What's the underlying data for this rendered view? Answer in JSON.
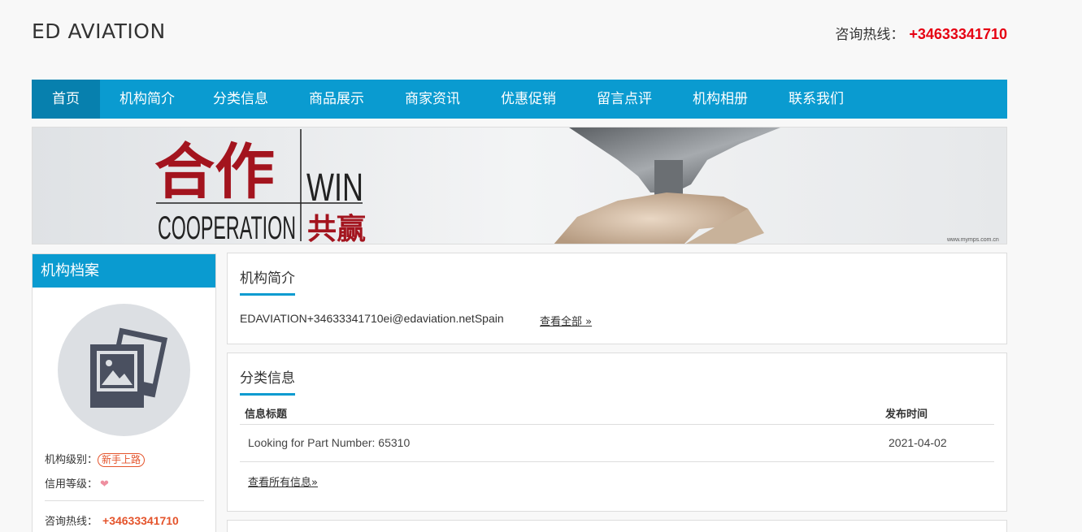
{
  "header": {
    "site_name": "ED AVIATION",
    "hotline_label": "咨询热线：",
    "hotline_number": "+34633341710"
  },
  "nav": {
    "items": [
      {
        "label": "首页",
        "active": true
      },
      {
        "label": "机构简介"
      },
      {
        "label": "分类信息"
      },
      {
        "label": "商品展示"
      },
      {
        "label": "商家资讯"
      },
      {
        "label": "优惠促销"
      },
      {
        "label": "留言点评"
      },
      {
        "label": "机构相册"
      },
      {
        "label": "联系我们"
      }
    ]
  },
  "banner": {
    "chinese_top": "合作",
    "win": "WIN",
    "cooperation": "COOPERATION",
    "chinese_bottom": "共赢",
    "watermark": "www.mymps.com.cn"
  },
  "sidebar": {
    "title": "机构档案",
    "avatar_icon": "photo-placeholder-icon",
    "level_label": "机构级别：",
    "level_badge": "新手上路",
    "credit_label": "信用等级：",
    "credit_icon": "heart-icon",
    "hotline_label": "咨询热线：",
    "hotline_number": "+34633341710"
  },
  "intro": {
    "title": "机构简介",
    "text": "EDAVIATION+34633341710ei@edaviation.netSpain",
    "view_all": "查看全部 »"
  },
  "classified": {
    "title": "分类信息",
    "columns": [
      "信息标题",
      "发布时间"
    ],
    "rows": [
      {
        "title": "Looking for Part Number: 65310",
        "date": "2021-04-02"
      }
    ],
    "more": "查看所有信息»"
  },
  "colors": {
    "accent": "#0a9bd0",
    "nav_active": "#0780ae",
    "hotline_red": "#e60012",
    "badge_orange": "#e4542c"
  }
}
